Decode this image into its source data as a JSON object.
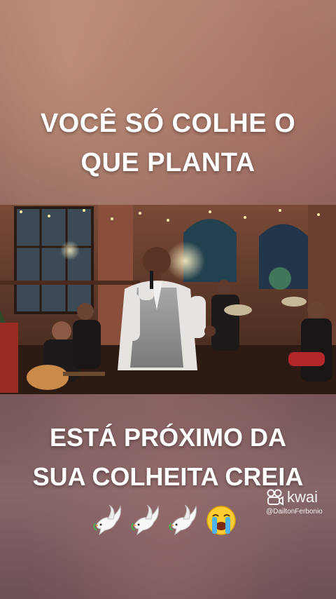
{
  "captions": {
    "top_line1": "VOCÊ SÓ COLHE O",
    "top_line2": "QUE PLANTA",
    "bottom_line1": "ESTÁ PRÓXIMO DA",
    "bottom_line2": "SUA COLHEITA CREIA"
  },
  "emojis": [
    "dove-icon",
    "dove-icon",
    "dove-icon",
    "loudly-crying-face-icon"
  ],
  "watermark": {
    "brand": "kwai",
    "username": "@DailtonFerbonio"
  },
  "colors": {
    "caption_text": "#ffffff",
    "background_top": "#a07468",
    "background_bottom": "#6c4f55"
  }
}
